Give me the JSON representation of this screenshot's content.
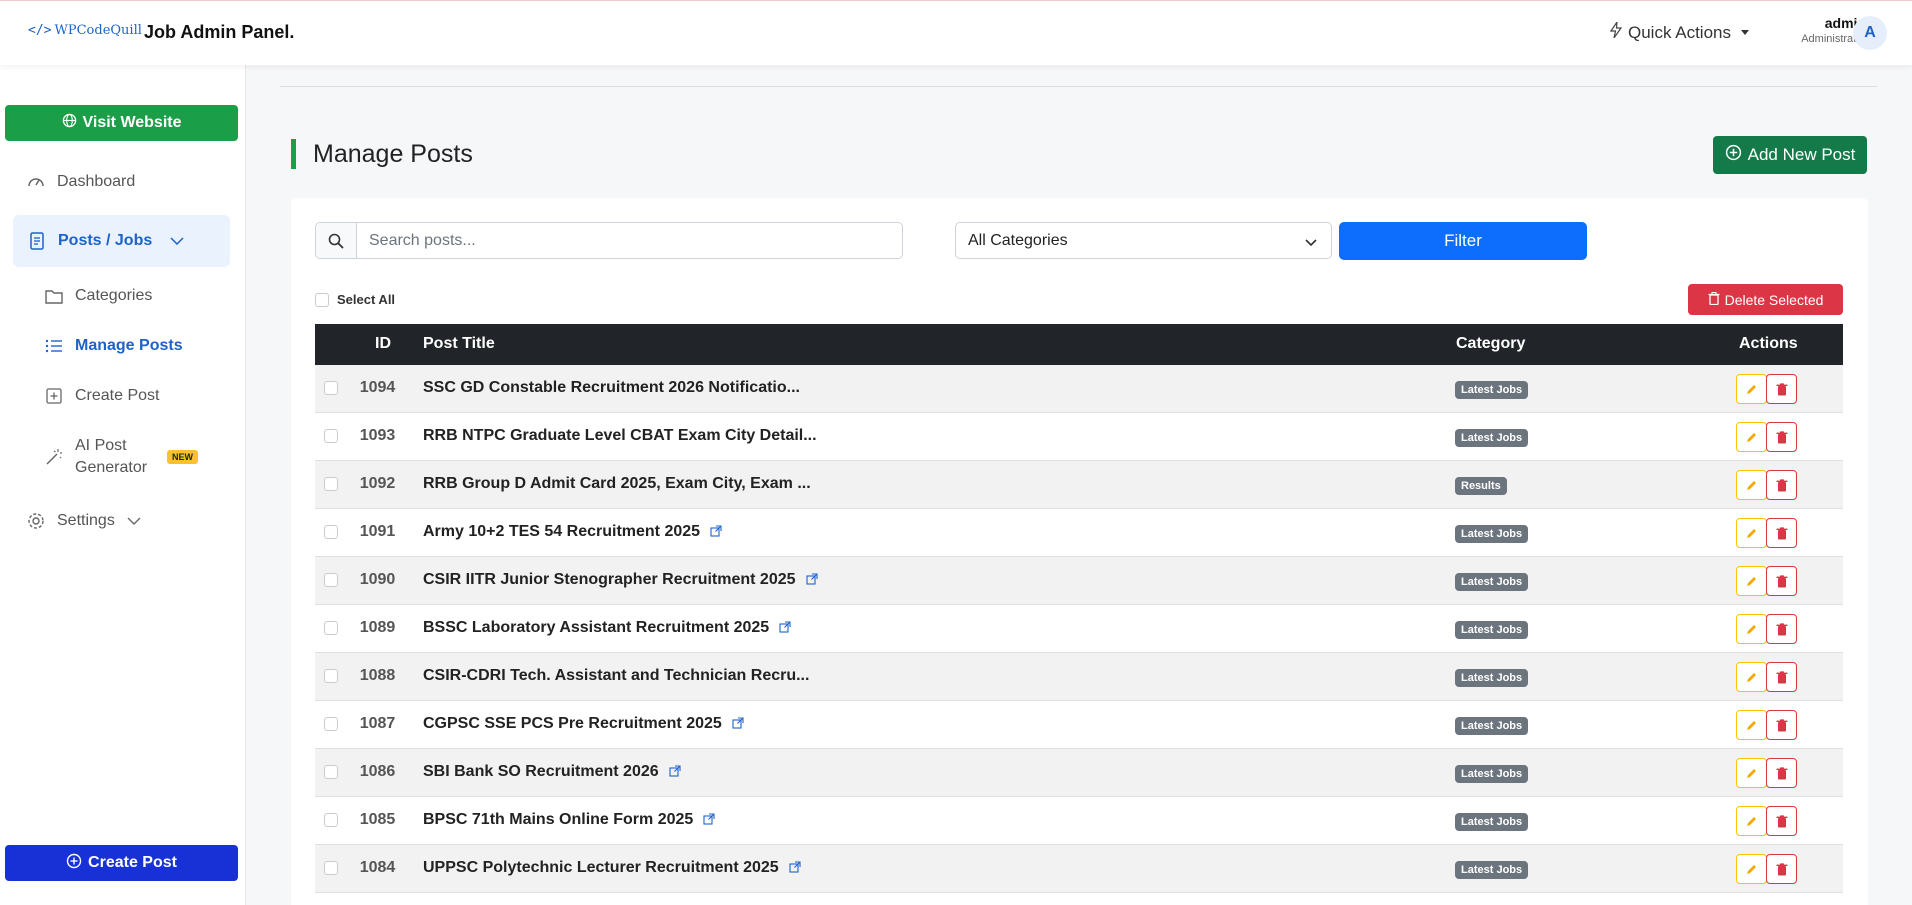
{
  "header": {
    "logo_text": "WPCodeQuill",
    "logo_code": "</>",
    "brand": "Job Admin Panel.",
    "quick_actions": "Quick Actions",
    "user_name": "admin",
    "user_role": "Administrator",
    "avatar_initial": "A"
  },
  "sidebar": {
    "visit_website": "Visit Website",
    "dashboard": "Dashboard",
    "posts_jobs": "Posts / Jobs",
    "categories": "Categories",
    "manage_posts": "Manage Posts",
    "create_post": "Create Post",
    "ai_post": "AI Post",
    "ai_generator": "Generator",
    "new_badge": "NEW",
    "settings": "Settings",
    "create_post_button": "Create Post"
  },
  "main": {
    "title": "Manage Posts",
    "add_new_post": "Add New Post",
    "search_placeholder": "Search posts...",
    "category_selected": "All Categories",
    "filter": "Filter",
    "select_all": "Select All",
    "delete_selected": "Delete Selected"
  },
  "table": {
    "headers": {
      "id": "ID",
      "title": "Post Title",
      "category": "Category",
      "actions": "Actions"
    },
    "rows": [
      {
        "id": "1094",
        "title": "SSC GD Constable Recruitment 2026 Notificatio...",
        "category": "Latest Jobs",
        "external": false
      },
      {
        "id": "1093",
        "title": "RRB NTPC Graduate Level CBAT Exam City Detail...",
        "category": "Latest Jobs",
        "external": false
      },
      {
        "id": "1092",
        "title": "RRB Group D Admit Card 2025, Exam City, Exam ...",
        "category": "Results",
        "external": false
      },
      {
        "id": "1091",
        "title": "Army 10+2 TES 54 Recruitment 2025",
        "category": "Latest Jobs",
        "external": true
      },
      {
        "id": "1090",
        "title": "CSIR IITR Junior Stenographer Recruitment 2025",
        "category": "Latest Jobs",
        "external": true
      },
      {
        "id": "1089",
        "title": "BSSC Laboratory Assistant Recruitment 2025",
        "category": "Latest Jobs",
        "external": true
      },
      {
        "id": "1088",
        "title": "CSIR-CDRI Tech. Assistant and Technician Recru...",
        "category": "Latest Jobs",
        "external": false
      },
      {
        "id": "1087",
        "title": "CGPSC SSE PCS Pre Recruitment 2025",
        "category": "Latest Jobs",
        "external": true
      },
      {
        "id": "1086",
        "title": "SBI Bank SO Recruitment 2026",
        "category": "Latest Jobs",
        "external": true
      },
      {
        "id": "1085",
        "title": "BPSC 71th Mains Online Form 2025",
        "category": "Latest Jobs",
        "external": true
      },
      {
        "id": "1084",
        "title": "UPPSC Polytechnic Lecturer Recruitment 2025",
        "category": "Latest Jobs",
        "external": true
      }
    ]
  },
  "colors": {
    "accent_green": "#1a9e48",
    "primary_blue": "#0d6efd",
    "danger": "#dc3545",
    "warning": "#ffc107",
    "create_blue": "#1731d6"
  }
}
